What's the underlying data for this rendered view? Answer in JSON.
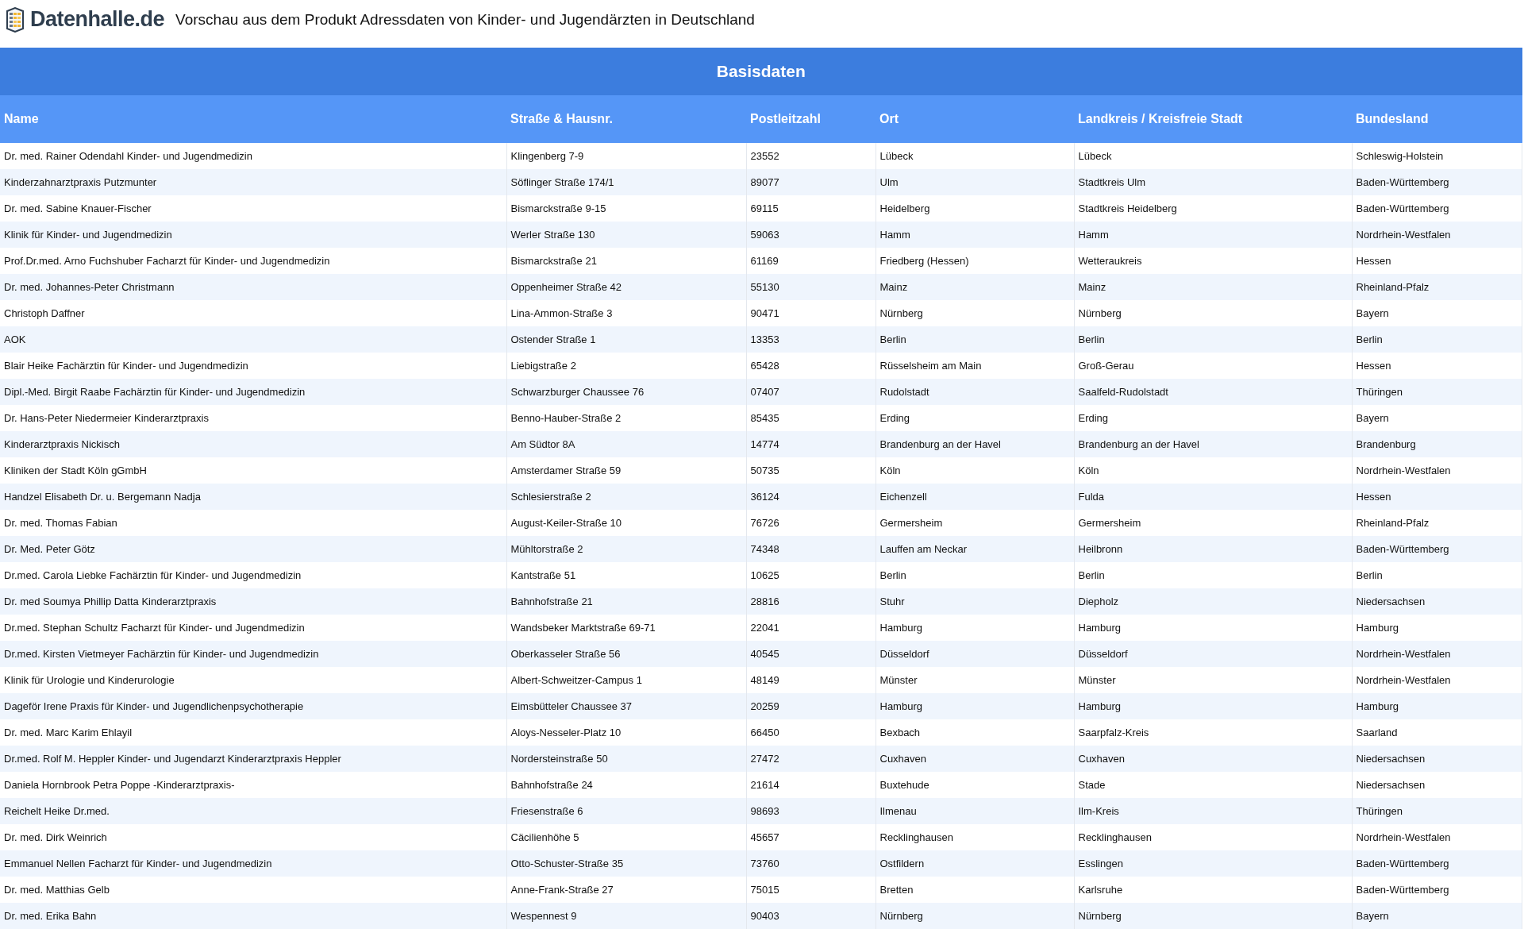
{
  "header": {
    "logo_text": "Datenhalle.de",
    "title": "Vorschau aus dem Produkt Adressdaten von Kinder- und Jugendärzten in Deutschland"
  },
  "table": {
    "caption": "Basisdaten",
    "columns": [
      "Name",
      "Straße & Hausnr.",
      "Postleitzahl",
      "Ort",
      "Landkreis / Kreisfreie Stadt",
      "Bundesland"
    ],
    "rows": [
      [
        "Dr. med. Rainer Odendahl Kinder- und Jugendmedizin",
        "Klingenberg 7-9",
        "23552",
        "Lübeck",
        "Lübeck",
        "Schleswig-Holstein"
      ],
      [
        "Kinderzahnarztpraxis Putzmunter",
        "Söflinger Straße 174/1",
        "89077",
        "Ulm",
        "Stadtkreis Ulm",
        "Baden-Württemberg"
      ],
      [
        "Dr. med. Sabine Knauer-Fischer",
        "Bismarckstraße 9-15",
        "69115",
        "Heidelberg",
        "Stadtkreis Heidelberg",
        "Baden-Württemberg"
      ],
      [
        "Klinik für Kinder- und Jugendmedizin",
        "Werler Straße 130",
        "59063",
        "Hamm",
        "Hamm",
        "Nordrhein-Westfalen"
      ],
      [
        "Prof.Dr.med. Arno Fuchshuber Facharzt für Kinder- und Jugendmedizin",
        "Bismarckstraße 21",
        "61169",
        "Friedberg (Hessen)",
        "Wetteraukreis",
        "Hessen"
      ],
      [
        "Dr. med. Johannes-Peter Christmann",
        "Oppenheimer Straße 42",
        "55130",
        "Mainz",
        "Mainz",
        "Rheinland-Pfalz"
      ],
      [
        "Christoph Daffner",
        "Lina-Ammon-Straße 3",
        "90471",
        "Nürnberg",
        "Nürnberg",
        "Bayern"
      ],
      [
        "AOK",
        "Ostender Straße 1",
        "13353",
        "Berlin",
        "Berlin",
        "Berlin"
      ],
      [
        "Blair Heike Fachärztin für Kinder- und Jugendmedizin",
        "Liebigstraße 2",
        "65428",
        "Rüsselsheim am Main",
        "Groß-Gerau",
        "Hessen"
      ],
      [
        "Dipl.-Med. Birgit Raabe Fachärztin für Kinder- und Jugendmedizin",
        "Schwarzburger Chaussee 76",
        "07407",
        "Rudolstadt",
        "Saalfeld-Rudolstadt",
        "Thüringen"
      ],
      [
        "Dr. Hans-Peter Niedermeier Kinderarztpraxis",
        "Benno-Hauber-Straße 2",
        "85435",
        "Erding",
        "Erding",
        "Bayern"
      ],
      [
        "Kinderarztpraxis Nickisch",
        "Am Südtor 8A",
        "14774",
        "Brandenburg an der Havel",
        "Brandenburg an der Havel",
        "Brandenburg"
      ],
      [
        "Kliniken der Stadt Köln gGmbH",
        "Amsterdamer Straße 59",
        "50735",
        "Köln",
        "Köln",
        "Nordrhein-Westfalen"
      ],
      [
        "Handzel Elisabeth Dr. u. Bergemann Nadja",
        "Schlesierstraße 2",
        "36124",
        "Eichenzell",
        "Fulda",
        "Hessen"
      ],
      [
        "Dr. med. Thomas Fabian",
        "August-Keiler-Straße 10",
        "76726",
        "Germersheim",
        "Germersheim",
        "Rheinland-Pfalz"
      ],
      [
        "Dr. Med. Peter Götz",
        "Mühltorstraße 2",
        "74348",
        "Lauffen am Neckar",
        "Heilbronn",
        "Baden-Württemberg"
      ],
      [
        "Dr.med. Carola Liebke Fachärztin für Kinder- und Jugendmedizin",
        "Kantstraße 51",
        "10625",
        "Berlin",
        "Berlin",
        "Berlin"
      ],
      [
        "Dr. med Soumya Phillip Datta Kinderarztpraxis",
        "Bahnhofstraße 21",
        "28816",
        "Stuhr",
        "Diepholz",
        "Niedersachsen"
      ],
      [
        "Dr.med. Stephan Schultz Facharzt für Kinder- und Jugendmedizin",
        "Wandsbeker Marktstraße 69-71",
        "22041",
        "Hamburg",
        "Hamburg",
        "Hamburg"
      ],
      [
        "Dr.med. Kirsten Vietmeyer Fachärztin für Kinder- und Jugendmedizin",
        "Oberkasseler Straße 56",
        "40545",
        "Düsseldorf",
        "Düsseldorf",
        "Nordrhein-Westfalen"
      ],
      [
        "Klinik für Urologie und Kinderurologie",
        "Albert-Schweitzer-Campus 1",
        "48149",
        "Münster",
        "Münster",
        "Nordrhein-Westfalen"
      ],
      [
        "Dageför Irene Praxis für Kinder- und Jugendlichenpsychotherapie",
        "Eimsbütteler Chaussee 37",
        "20259",
        "Hamburg",
        "Hamburg",
        "Hamburg"
      ],
      [
        "Dr. med. Marc Karim Ehlayil",
        "Aloys-Nesseler-Platz 10",
        "66450",
        "Bexbach",
        "Saarpfalz-Kreis",
        "Saarland"
      ],
      [
        "Dr.med. Rolf M. Heppler Kinder- und Jugendarzt Kinderarztpraxis Heppler",
        "Nordersteinstraße 50",
        "27472",
        "Cuxhaven",
        "Cuxhaven",
        "Niedersachsen"
      ],
      [
        "Daniela Hornbrook Petra Poppe -Kinderarztpraxis-",
        "Bahnhofstraße 24",
        "21614",
        "Buxtehude",
        "Stade",
        "Niedersachsen"
      ],
      [
        "Reichelt Heike Dr.med.",
        "Friesenstraße 6",
        "98693",
        "Ilmenau",
        "Ilm-Kreis",
        "Thüringen"
      ],
      [
        "Dr. med. Dirk Weinrich",
        "Cäcilienhöhe 5",
        "45657",
        "Recklinghausen",
        "Recklinghausen",
        "Nordrhein-Westfalen"
      ],
      [
        "Emmanuel Nellen Facharzt für Kinder- und Jugendmedizin",
        "Otto-Schuster-Straße 35",
        "73760",
        "Ostfildern",
        "Esslingen",
        "Baden-Württemberg"
      ],
      [
        "Dr. med. Matthias Gelb",
        "Anne-Frank-Straße 27",
        "75015",
        "Bretten",
        "Karlsruhe",
        "Baden-Württemberg"
      ],
      [
        "Dr. med. Erika Bahn",
        "Wespennest 9",
        "90403",
        "Nürnberg",
        "Nürnberg",
        "Bayern"
      ]
    ]
  }
}
